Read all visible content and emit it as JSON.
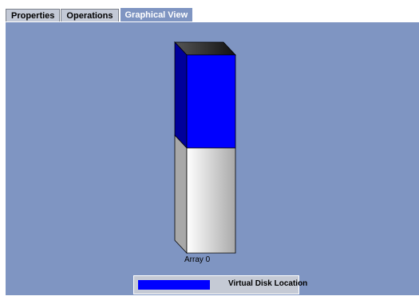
{
  "tabs": [
    {
      "label": "Properties",
      "active": false
    },
    {
      "label": "Operations",
      "active": false
    },
    {
      "label": "Graphical View",
      "active": true
    }
  ],
  "chart_data": {
    "type": "bar",
    "categories": [
      "Array 0"
    ],
    "series": [
      {
        "value_fraction": 0.47,
        "color": "#0000ff"
      }
    ],
    "remaining_color": "#d9d9d9"
  },
  "legend": {
    "label": "Virtual Disk Location",
    "color": "#0000ff"
  },
  "colors": {
    "background": "#7f95c2",
    "tab_inactive": "#c3c9d6",
    "legend_bg": "#c5cad5"
  }
}
